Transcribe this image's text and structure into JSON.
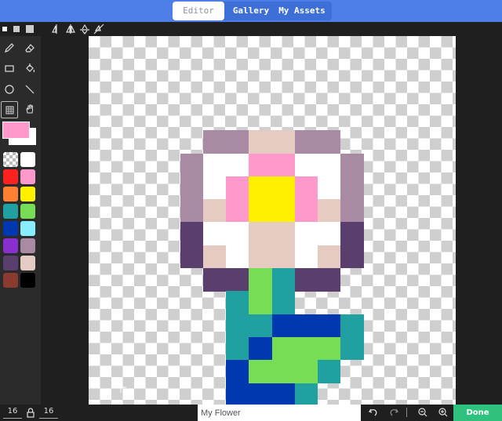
{
  "nav": {
    "tabs": [
      {
        "label": "Editor",
        "active": true
      },
      {
        "label": "Gallery",
        "active": false
      },
      {
        "label": "My Assets",
        "active": false
      }
    ]
  },
  "toolbar": {
    "brush_sizes": [
      "small",
      "medium",
      "large"
    ],
    "symmetry_icons": [
      "mirror-vertical-icon",
      "mirror-both-icon",
      "mirror-horizontal-icon",
      "mirror-diagonal-icon"
    ]
  },
  "tools": [
    "pencil-icon",
    "eraser-icon",
    "rectangle-icon",
    "fill-bucket-icon",
    "circle-icon",
    "line-icon",
    "grid-toggle-icon",
    "hand-pan-icon"
  ],
  "colors": {
    "primary": "#ff99cc",
    "secondary": "#ffffff",
    "palette": [
      "transparent",
      "#ffffff",
      "#ff2020",
      "#ff99cc",
      "#ff8030",
      "#fff000",
      "#20a0a0",
      "#77dd55",
      "#0038b0",
      "#88eeff",
      "#8a2fcf",
      "#a88aa3",
      "#5a3f6e",
      "#e6cbc3",
      "#8b3a30",
      "#000000"
    ]
  },
  "canvas": {
    "grid_cols": 16,
    "grid_rows": 16,
    "pixels": [
      {
        "r": 4,
        "c": 5,
        "color": "#a88aa3"
      },
      {
        "r": 4,
        "c": 6,
        "color": "#a88aa3"
      },
      {
        "r": 4,
        "c": 7,
        "color": "#e6cbc3"
      },
      {
        "r": 4,
        "c": 8,
        "color": "#e6cbc3"
      },
      {
        "r": 4,
        "c": 9,
        "color": "#a88aa3"
      },
      {
        "r": 4,
        "c": 10,
        "color": "#a88aa3"
      },
      {
        "r": 5,
        "c": 4,
        "color": "#a88aa3"
      },
      {
        "r": 5,
        "c": 5,
        "color": "#ffffff"
      },
      {
        "r": 5,
        "c": 6,
        "color": "#ffffff"
      },
      {
        "r": 5,
        "c": 7,
        "color": "#ff99cc"
      },
      {
        "r": 5,
        "c": 8,
        "color": "#ff99cc"
      },
      {
        "r": 5,
        "c": 9,
        "color": "#ffffff"
      },
      {
        "r": 5,
        "c": 10,
        "color": "#ffffff"
      },
      {
        "r": 5,
        "c": 11,
        "color": "#a88aa3"
      },
      {
        "r": 6,
        "c": 4,
        "color": "#a88aa3"
      },
      {
        "r": 6,
        "c": 5,
        "color": "#ffffff"
      },
      {
        "r": 6,
        "c": 6,
        "color": "#ff99cc"
      },
      {
        "r": 6,
        "c": 7,
        "color": "#fff000"
      },
      {
        "r": 6,
        "c": 8,
        "color": "#fff000"
      },
      {
        "r": 6,
        "c": 9,
        "color": "#ff99cc"
      },
      {
        "r": 6,
        "c": 10,
        "color": "#ffffff"
      },
      {
        "r": 6,
        "c": 11,
        "color": "#a88aa3"
      },
      {
        "r": 7,
        "c": 4,
        "color": "#a88aa3"
      },
      {
        "r": 7,
        "c": 5,
        "color": "#e6cbc3"
      },
      {
        "r": 7,
        "c": 6,
        "color": "#ff99cc"
      },
      {
        "r": 7,
        "c": 7,
        "color": "#fff000"
      },
      {
        "r": 7,
        "c": 8,
        "color": "#fff000"
      },
      {
        "r": 7,
        "c": 9,
        "color": "#ff99cc"
      },
      {
        "r": 7,
        "c": 10,
        "color": "#e6cbc3"
      },
      {
        "r": 7,
        "c": 11,
        "color": "#a88aa3"
      },
      {
        "r": 8,
        "c": 4,
        "color": "#5a3f6e"
      },
      {
        "r": 8,
        "c": 5,
        "color": "#ffffff"
      },
      {
        "r": 8,
        "c": 6,
        "color": "#ffffff"
      },
      {
        "r": 8,
        "c": 7,
        "color": "#e6cbc3"
      },
      {
        "r": 8,
        "c": 8,
        "color": "#e6cbc3"
      },
      {
        "r": 8,
        "c": 9,
        "color": "#ffffff"
      },
      {
        "r": 8,
        "c": 10,
        "color": "#ffffff"
      },
      {
        "r": 8,
        "c": 11,
        "color": "#5a3f6e"
      },
      {
        "r": 9,
        "c": 4,
        "color": "#5a3f6e"
      },
      {
        "r": 9,
        "c": 5,
        "color": "#e6cbc3"
      },
      {
        "r": 9,
        "c": 6,
        "color": "#ffffff"
      },
      {
        "r": 9,
        "c": 7,
        "color": "#e6cbc3"
      },
      {
        "r": 9,
        "c": 8,
        "color": "#e6cbc3"
      },
      {
        "r": 9,
        "c": 9,
        "color": "#ffffff"
      },
      {
        "r": 9,
        "c": 10,
        "color": "#e6cbc3"
      },
      {
        "r": 9,
        "c": 11,
        "color": "#5a3f6e"
      },
      {
        "r": 10,
        "c": 5,
        "color": "#5a3f6e"
      },
      {
        "r": 10,
        "c": 6,
        "color": "#5a3f6e"
      },
      {
        "r": 10,
        "c": 7,
        "color": "#77dd55"
      },
      {
        "r": 10,
        "c": 8,
        "color": "#20a0a0"
      },
      {
        "r": 10,
        "c": 9,
        "color": "#5a3f6e"
      },
      {
        "r": 10,
        "c": 10,
        "color": "#5a3f6e"
      },
      {
        "r": 11,
        "c": 6,
        "color": "#20a0a0"
      },
      {
        "r": 11,
        "c": 7,
        "color": "#77dd55"
      },
      {
        "r": 11,
        "c": 8,
        "color": "#20a0a0"
      },
      {
        "r": 12,
        "c": 6,
        "color": "#20a0a0"
      },
      {
        "r": 12,
        "c": 7,
        "color": "#20a0a0"
      },
      {
        "r": 12,
        "c": 8,
        "color": "#0038b0"
      },
      {
        "r": 12,
        "c": 9,
        "color": "#0038b0"
      },
      {
        "r": 12,
        "c": 10,
        "color": "#0038b0"
      },
      {
        "r": 12,
        "c": 11,
        "color": "#20a0a0"
      },
      {
        "r": 13,
        "c": 6,
        "color": "#20a0a0"
      },
      {
        "r": 13,
        "c": 7,
        "color": "#0038b0"
      },
      {
        "r": 13,
        "c": 8,
        "color": "#77dd55"
      },
      {
        "r": 13,
        "c": 9,
        "color": "#77dd55"
      },
      {
        "r": 13,
        "c": 10,
        "color": "#77dd55"
      },
      {
        "r": 13,
        "c": 11,
        "color": "#20a0a0"
      },
      {
        "r": 14,
        "c": 6,
        "color": "#0038b0"
      },
      {
        "r": 14,
        "c": 7,
        "color": "#77dd55"
      },
      {
        "r": 14,
        "c": 8,
        "color": "#77dd55"
      },
      {
        "r": 14,
        "c": 9,
        "color": "#77dd55"
      },
      {
        "r": 14,
        "c": 10,
        "color": "#20a0a0"
      },
      {
        "r": 15,
        "c": 6,
        "color": "#0038b0"
      },
      {
        "r": 15,
        "c": 7,
        "color": "#0038b0"
      },
      {
        "r": 15,
        "c": 8,
        "color": "#0038b0"
      },
      {
        "r": 15,
        "c": 9,
        "color": "#20a0a0"
      }
    ]
  },
  "footer": {
    "width": "16",
    "height": "16",
    "name_value": "My Flower",
    "done_label": "Done"
  }
}
